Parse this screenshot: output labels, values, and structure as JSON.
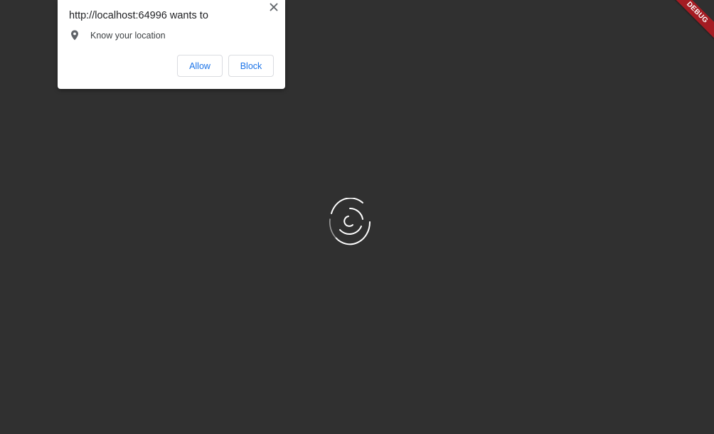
{
  "permission_prompt": {
    "title": "http://localhost:64996 wants to",
    "permission_icon": "location-pin-icon",
    "permission_label": "Know your location",
    "allow_label": "Allow",
    "block_label": "Block",
    "close_icon": "close-icon",
    "accent_color": "#1a73e8"
  },
  "page": {
    "background_color": "#303030",
    "loading_indicator": "loading-spinner-icon"
  },
  "debug_banner": {
    "label": "DEBUG",
    "color": "#a41c23"
  }
}
